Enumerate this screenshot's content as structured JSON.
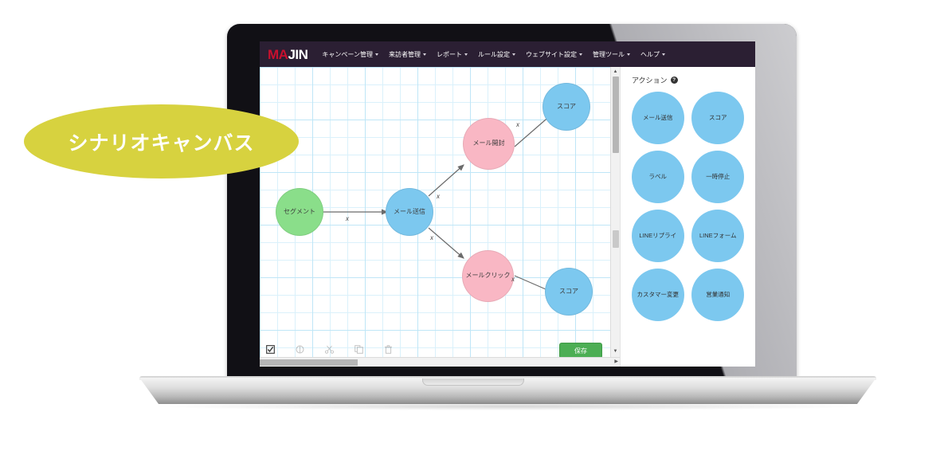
{
  "callout": {
    "label": "シナリオキャンバス"
  },
  "app": {
    "logo": {
      "part1": "MA",
      "part2": "JIN"
    },
    "nav": [
      {
        "label": "キャンペーン管理",
        "caret": "chevron-down-icon"
      },
      {
        "label": "来訪者管理",
        "caret": "chevron-down-icon"
      },
      {
        "label": "レポート",
        "caret": "chevron-down-icon"
      },
      {
        "label": "ルール設定",
        "caret": "chevron-down-icon"
      },
      {
        "label": "ウェブサイト設定",
        "caret": "chevron-down-icon"
      },
      {
        "label": "管理ツール",
        "caret": "chevron-down-icon"
      },
      {
        "label": "ヘルプ",
        "caret": "chevron-down-icon"
      }
    ]
  },
  "canvas": {
    "nodes": [
      {
        "label": "セグメント",
        "type": "segment",
        "color": "#8ade8a"
      },
      {
        "label": "メール送信",
        "type": "action",
        "color": "#7cc8ef"
      },
      {
        "label": "メール開封",
        "type": "condition",
        "color": "#f9b7c4"
      },
      {
        "label": "メールクリック",
        "type": "condition",
        "color": "#f9b7c4"
      },
      {
        "label": "スコア",
        "type": "action",
        "color": "#7cc8ef"
      },
      {
        "label": "スコア",
        "type": "action",
        "color": "#7cc8ef"
      }
    ],
    "edge_labels": [
      "x",
      "x",
      "x",
      "x",
      "x"
    ],
    "toolbar_icons": [
      "select-checkbox-icon",
      "undo-circle-icon",
      "cut-scissors-icon",
      "copy-icon",
      "delete-trash-icon"
    ],
    "save_label": "保存",
    "scrollbar_up": "▲",
    "scrollbar_down": "▼",
    "hscroll_right": "▶"
  },
  "action_panel": {
    "title": "アクション",
    "help_icon": "help-question-icon",
    "help_glyph": "?",
    "items": [
      {
        "label": "メール送信"
      },
      {
        "label": "スコア"
      },
      {
        "label": "ラベル"
      },
      {
        "label": "一時停止"
      },
      {
        "label": "LINEリプライ"
      },
      {
        "label": "LINEフォーム"
      },
      {
        "label": "カスタマー変更"
      },
      {
        "label": "営業通知"
      }
    ]
  },
  "pointer": {
    "icon": "mouse-click-icon",
    "color": "#e35d5d"
  },
  "colors": {
    "navbar": "#2b1f33",
    "logo_accent": "#c8102e",
    "node_green": "#8ade8a",
    "node_blue": "#7cc8ef",
    "node_pink": "#f9b7c4",
    "save_green": "#4cae54",
    "callout_yellow": "#d7d23f",
    "grid_line": "#bfe6f7"
  }
}
